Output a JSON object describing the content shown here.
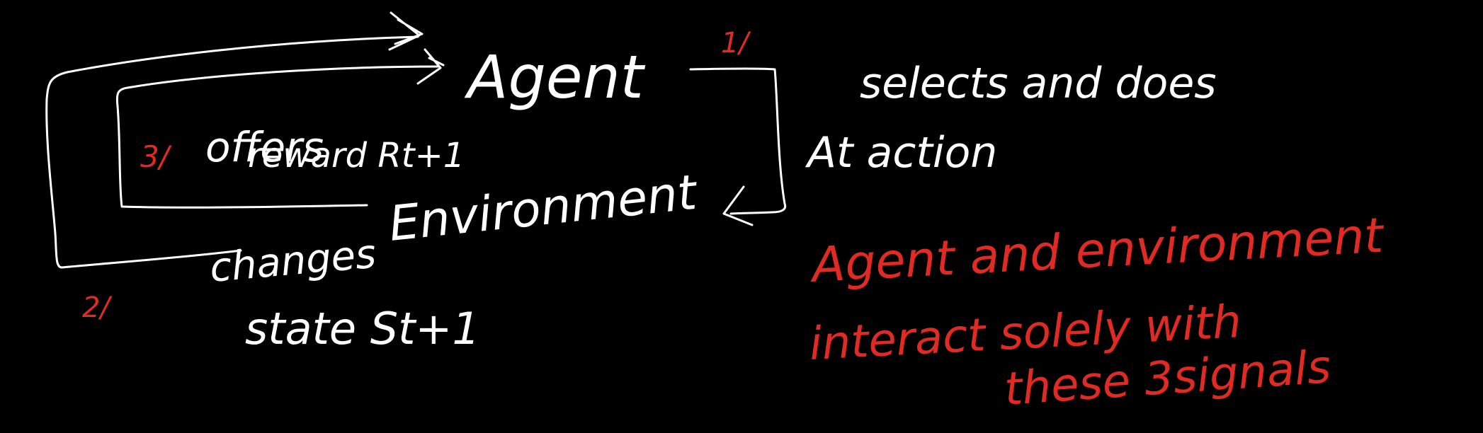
{
  "colors": {
    "background": "#000000",
    "ink": "#ffffff",
    "accent": "#e02a22"
  },
  "nodes": {
    "agent": "Agent",
    "environment": "Environment"
  },
  "step1": {
    "number": "1/",
    "action_line1": "selects and does",
    "action_line2": "At action"
  },
  "step2": {
    "number": "2/",
    "state_line1": "changes",
    "state_line2": "state St+1"
  },
  "step3": {
    "number": "3/",
    "reward_line1": "offers",
    "reward_line2": "reward Rt+1"
  },
  "note": {
    "line1": "Agent and environment",
    "line2": "interact solely with",
    "line3": "these 3signals"
  }
}
